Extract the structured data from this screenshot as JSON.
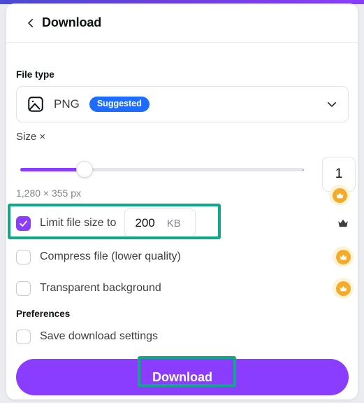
{
  "window": {
    "accent_color": "#8b3dff",
    "badge_color": "#1d6bff",
    "highlight_color": "#0fa888",
    "crown_color": "#f5ab2a"
  },
  "header": {
    "back_icon": "chevron-left-icon",
    "title": "Download"
  },
  "file_type": {
    "label": "File type",
    "icon": "image-file-icon",
    "value": "PNG",
    "badge": "Suggested",
    "chevron_icon": "chevron-down-icon"
  },
  "size": {
    "label": "Size ×",
    "multiplier": "1",
    "dimensions": "1,280 × 355 px",
    "slider_percent": 22,
    "crown_icon": "crown-icon"
  },
  "options": [
    {
      "label": "Limit file size to",
      "checked": true,
      "value": "200",
      "unit": "KB",
      "crown": "crown-plain-icon",
      "highlighted": true
    },
    {
      "label": "Compress file (lower quality)",
      "checked": false,
      "crown": "crown-icon",
      "highlighted": false
    },
    {
      "label": "Transparent background",
      "checked": false,
      "crown": "crown-icon",
      "highlighted": false
    }
  ],
  "preferences": {
    "label": "Preferences",
    "save_settings": {
      "label": "Save download settings",
      "checked": false
    }
  },
  "download_button": {
    "label": "Download"
  }
}
